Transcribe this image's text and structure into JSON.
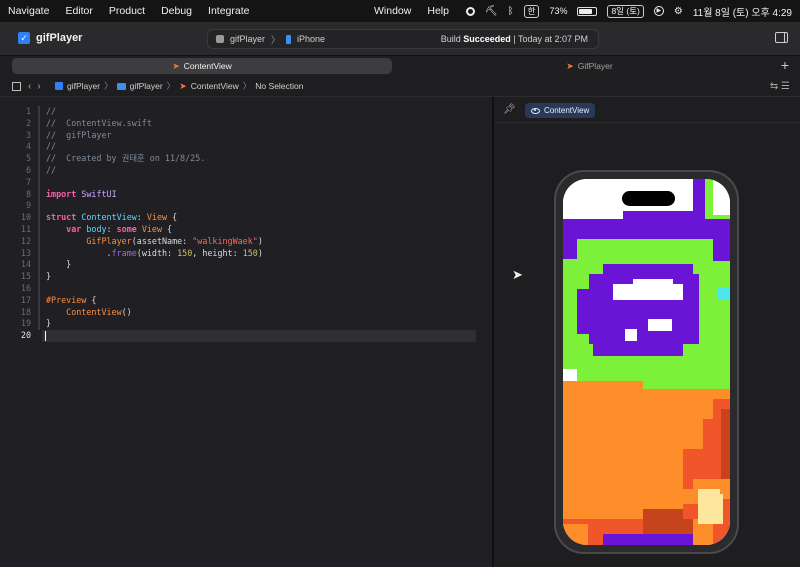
{
  "menubar": {
    "items": [
      "Navigate",
      "Editor",
      "Product",
      "Debug",
      "Integrate"
    ],
    "mid_items": [
      "Window",
      "Help"
    ],
    "input_method": "한",
    "battery_percent": "73%",
    "date_chip": "8일 (토)",
    "clock": "11월 8일 (토) 오후 4:29"
  },
  "toolbar": {
    "project_name": "gifPlayer",
    "scheme_target": "gifPlayer",
    "scheme_device": "iPhone",
    "status_prefix": "Build",
    "status_bold": "Succeeded",
    "status_suffix": "| Today at 2:07 PM"
  },
  "tabs": [
    {
      "label": "ContentView",
      "active": true
    },
    {
      "label": "GifPlayer",
      "active": false
    }
  ],
  "jumpbar": {
    "crumbs": [
      "gifPlayer",
      "gifPlayer",
      "ContentView",
      "No Selection"
    ]
  },
  "editor": {
    "current_line": 20,
    "lines": [
      "//",
      "//  ContentView.swift",
      "//  gifPlayer",
      "//",
      "//  Created by 권태훈 on 11/8/25.",
      "//",
      "",
      "import SwiftUI",
      "",
      "struct ContentView: View {",
      "    var body: some View {",
      "        GifPlayer(assetName: \"walkingWaek\")",
      "            .frame(width: 150, height: 150)",
      "    }",
      "}",
      "",
      "#Preview {",
      "    ContentView()",
      "}",
      ""
    ]
  },
  "canvas": {
    "preview_label": "ContentView"
  },
  "colors": {
    "pixel_white": "#ffffff",
    "pixel_purple": "#6a14d6",
    "pixel_green": "#7df03a",
    "pixel_orange": "#fd8e2a",
    "pixel_dark_orange": "#c6431b",
    "pixel_red_orange": "#f0562a",
    "pixel_cream": "#fde79d",
    "pixel_cyan": "#4ee6ee"
  }
}
